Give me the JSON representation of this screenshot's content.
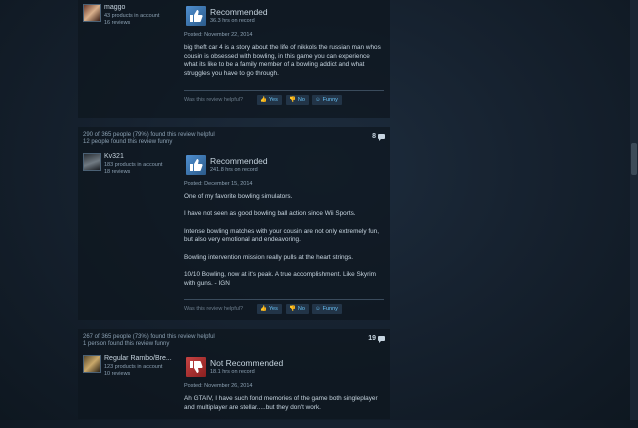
{
  "reviews": [
    {
      "helpful_line": "",
      "funny_line": "",
      "comment_count": "",
      "author": {
        "name": "maggo",
        "products": "43 products in account",
        "reviews": "16 reviews"
      },
      "verdict": "Recommended",
      "hours": "36.3 hrs on record",
      "posted": "Posted: November 22, 2014",
      "paragraphs": [
        "big theft car 4 is a story about the life of nikkols the russian man whos cousin is obsessed with bowling, in this game you can experience what its like to be a family member of a bowling addict and what struggles you have to go through."
      ],
      "helpful_question": "Was this review helpful?",
      "yes_label": "Yes",
      "no_label": "No",
      "funny_label": "Funny"
    },
    {
      "helpful_line": "290 of 365 people (79%) found this review helpful",
      "funny_line": "12 people found this review funny",
      "comment_count": "8",
      "author": {
        "name": "Kv321",
        "products": "183 products in account",
        "reviews": "18 reviews"
      },
      "verdict": "Recommended",
      "hours": "241.8 hrs on record",
      "posted": "Posted: December 15, 2014",
      "paragraphs": [
        "One of my favorite bowling simulators.",
        "I have not seen as good bowling ball action since Wii Sports.",
        "Intense bowling matches with your cousin are not only extremely fun, but also very emotional and endeavoring.",
        "Bowling intervention mission really pulls at the heart strings.",
        "10/10 Bowling, now at it's peak. A true accomplishment. Like Skyrim with guns. - IGN"
      ],
      "helpful_question": "Was this review helpful?",
      "yes_label": "Yes",
      "no_label": "No",
      "funny_label": "Funny"
    },
    {
      "helpful_line": "267 of 365 people (73%) found this review helpful",
      "funny_line": "1 person found this review funny",
      "comment_count": "19",
      "author": {
        "name": "Regular Rambo/Bre...",
        "products": "123 products in account",
        "reviews": "10 reviews"
      },
      "verdict": "Not Recommended",
      "hours": "18.1 hrs on record",
      "posted": "Posted: November 26, 2014",
      "paragraphs": [
        "Ah GTAIV, I have such fond memories of the game both singleplayer and multiplayer are stellar.....but they don't work."
      ],
      "helpful_question": "",
      "yes_label": "",
      "no_label": "",
      "funny_label": ""
    }
  ],
  "colors": {
    "accent": "#67c1f5",
    "recommended": "#4f8fd0",
    "not_recommended": "#c64343"
  },
  "icons": {
    "up": "thumbs-up-icon",
    "down": "thumbs-down-icon",
    "comment": "comment-icon"
  }
}
